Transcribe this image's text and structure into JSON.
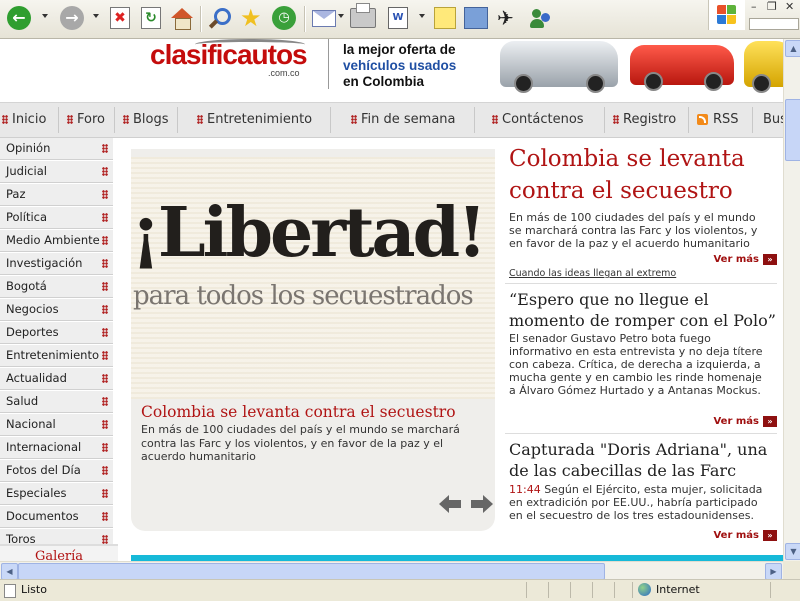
{
  "browser": {
    "toolbar_icons": [
      "back-icon",
      "forward-icon",
      "stop-icon",
      "refresh-icon",
      "home-icon",
      "search-icon",
      "favorites-icon",
      "history-icon",
      "mail-icon",
      "print-icon",
      "edit-word-icon",
      "discuss-icon",
      "research-icon",
      "messenger-icon",
      "msn-icon"
    ],
    "status_text": "Listo",
    "zone_text": "Internet"
  },
  "banner": {
    "logo_part1": "clasific",
    "logo_part2": "autos",
    "logo_suffix": ".com.co",
    "tagline_line1": "la mejor oferta de",
    "tagline_line2": "vehículos usados",
    "tagline_line3": "en Colombia"
  },
  "nav": {
    "items": [
      "Inicio",
      "Foro",
      "Blogs",
      "Entretenimiento",
      "Fin de semana",
      "Contáctenos",
      "Registro",
      "RSS",
      "Bus"
    ]
  },
  "sidebar": {
    "items": [
      "Opinión",
      "Judicial",
      "Paz",
      "Política",
      "Medio Ambiente",
      "Investigación",
      "Bogotá",
      "Negocios",
      "Deportes",
      "Entretenimiento",
      "Actualidad",
      "Salud",
      "Nacional",
      "Internacional",
      "Fotos del Día",
      "Especiales",
      "Documentos",
      "Toros"
    ],
    "gallery_label": "Galería"
  },
  "feature": {
    "hero_headline": "¡Libertad!",
    "hero_subline": "para todos los secuestrados",
    "title": "Colombia se levanta contra el secuestro",
    "text": "En más de 100 ciudades del país y el mundo se marchará contra las Farc y los violentos, y en favor de la paz y el acuerdo humanitario"
  },
  "news": [
    {
      "title": "Colombia se levanta contra el secuestro",
      "text": "En más de 100 ciudades del país y el mundo se marchará contra las Farc y los violentos, y en favor de la paz y el acuerdo humanitario",
      "more": "Ver más",
      "link": "Cuando las ideas llegan al extremo"
    },
    {
      "title": "“Espero que no llegue el momento de romper con el Polo”",
      "text": "El senador Gustavo Petro bota fuego informativo en esta entrevista y no deja títere con cabeza. Crítica, de derecha a izquierda, a mucha gente y en cambio les rinde homenaje a Álvaro Gómez Hurtado y a Antanas Mockus.",
      "more": "Ver más"
    },
    {
      "title": "Capturada \"Doris Adriana\", una de las cabecillas de las Farc",
      "time": "11:44",
      "text": "Según el Ejército, esta mujer, solicitada en extradición por EE.UU., habría participado en el secuestro de los tres estadounidenses.",
      "more": "Ver más"
    }
  ],
  "colors": {
    "accent_red": "#b01414",
    "cyan_bar": "#16b9d8"
  }
}
